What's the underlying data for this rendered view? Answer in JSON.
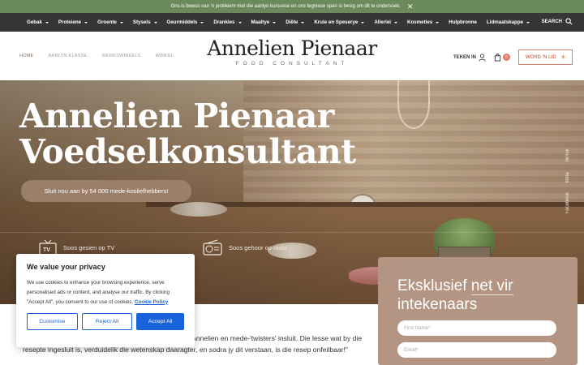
{
  "announcement": {
    "text": "Ons is bewus van 'n probleem met die aanlyn kursusse en ons tegniese span is besig om dit te ondersoek."
  },
  "main_nav": {
    "items": [
      {
        "label": "Gebak"
      },
      {
        "label": "Proteiene"
      },
      {
        "label": "Groente"
      },
      {
        "label": "Stysels"
      },
      {
        "label": "Geurmiddels"
      },
      {
        "label": "Drankies"
      },
      {
        "label": "Maaltye"
      },
      {
        "label": "Diëte"
      },
      {
        "label": "Kruie en Speserye"
      },
      {
        "label": "Allerlei"
      },
      {
        "label": "Kosmeties"
      },
      {
        "label": "Hulpbronne"
      },
      {
        "label": "Lidmaatskappe"
      }
    ],
    "search_label": "SEARCH"
  },
  "header": {
    "subnav": [
      {
        "label": "HOME"
      },
      {
        "label": "AANLYN KLASSE"
      },
      {
        "label": "WERKSWINKELS"
      },
      {
        "label": "WINKEL"
      }
    ],
    "logo_name": "Annelien Pienaar",
    "logo_sub": "FOOD CONSULTANT",
    "signin_label": "TEKEN IN",
    "cart_count": "0",
    "join_label": "WORD 'N LID"
  },
  "hero": {
    "title_line1": "Annelien Pienaar",
    "title_line2": "Voedselkonsultant",
    "cta_label": "Sluit nou aan by 54 000 mede-kosliefhebbers!",
    "media_tv": "Soos gesien op TV",
    "media_radio": "Soos gehoor op radio",
    "social": [
      "Facebook",
      "Insta",
      "TikTok"
    ]
  },
  "signup": {
    "title_pre": "Eksklusief ",
    "title_ul": "net vir",
    "title_line2": "intekenaars",
    "first_name_placeholder": "First Name*",
    "email_placeholder": "Email*"
  },
  "body": {
    "text": "…stiese resepte is daar 'n ondersteuningsnetwerk wat Annelien en mede-'twisters' insluit. Die lesse wat by die resepte ingesluit is, verduidelik die wetenskap daaragter, en sodra jy dit verstaan, is die resep onfeilbaar!\""
  },
  "cookie": {
    "title": "We value your privacy",
    "text": "We use cookies to enhance your browsing experience, serve personalised ads or content, and analyse our traffic. By clicking \"Accept All\", you consent to our use of cookies.",
    "policy_link": "Cookie Policy",
    "customise": "Customise",
    "reject": "Reject All",
    "accept": "Accept All"
  },
  "colors": {
    "announce": "#6b8a5c",
    "nav": "#363636",
    "accent": "#d9806b",
    "brand_brown": "#9c7f6b",
    "cookie_blue": "#1863dc"
  }
}
